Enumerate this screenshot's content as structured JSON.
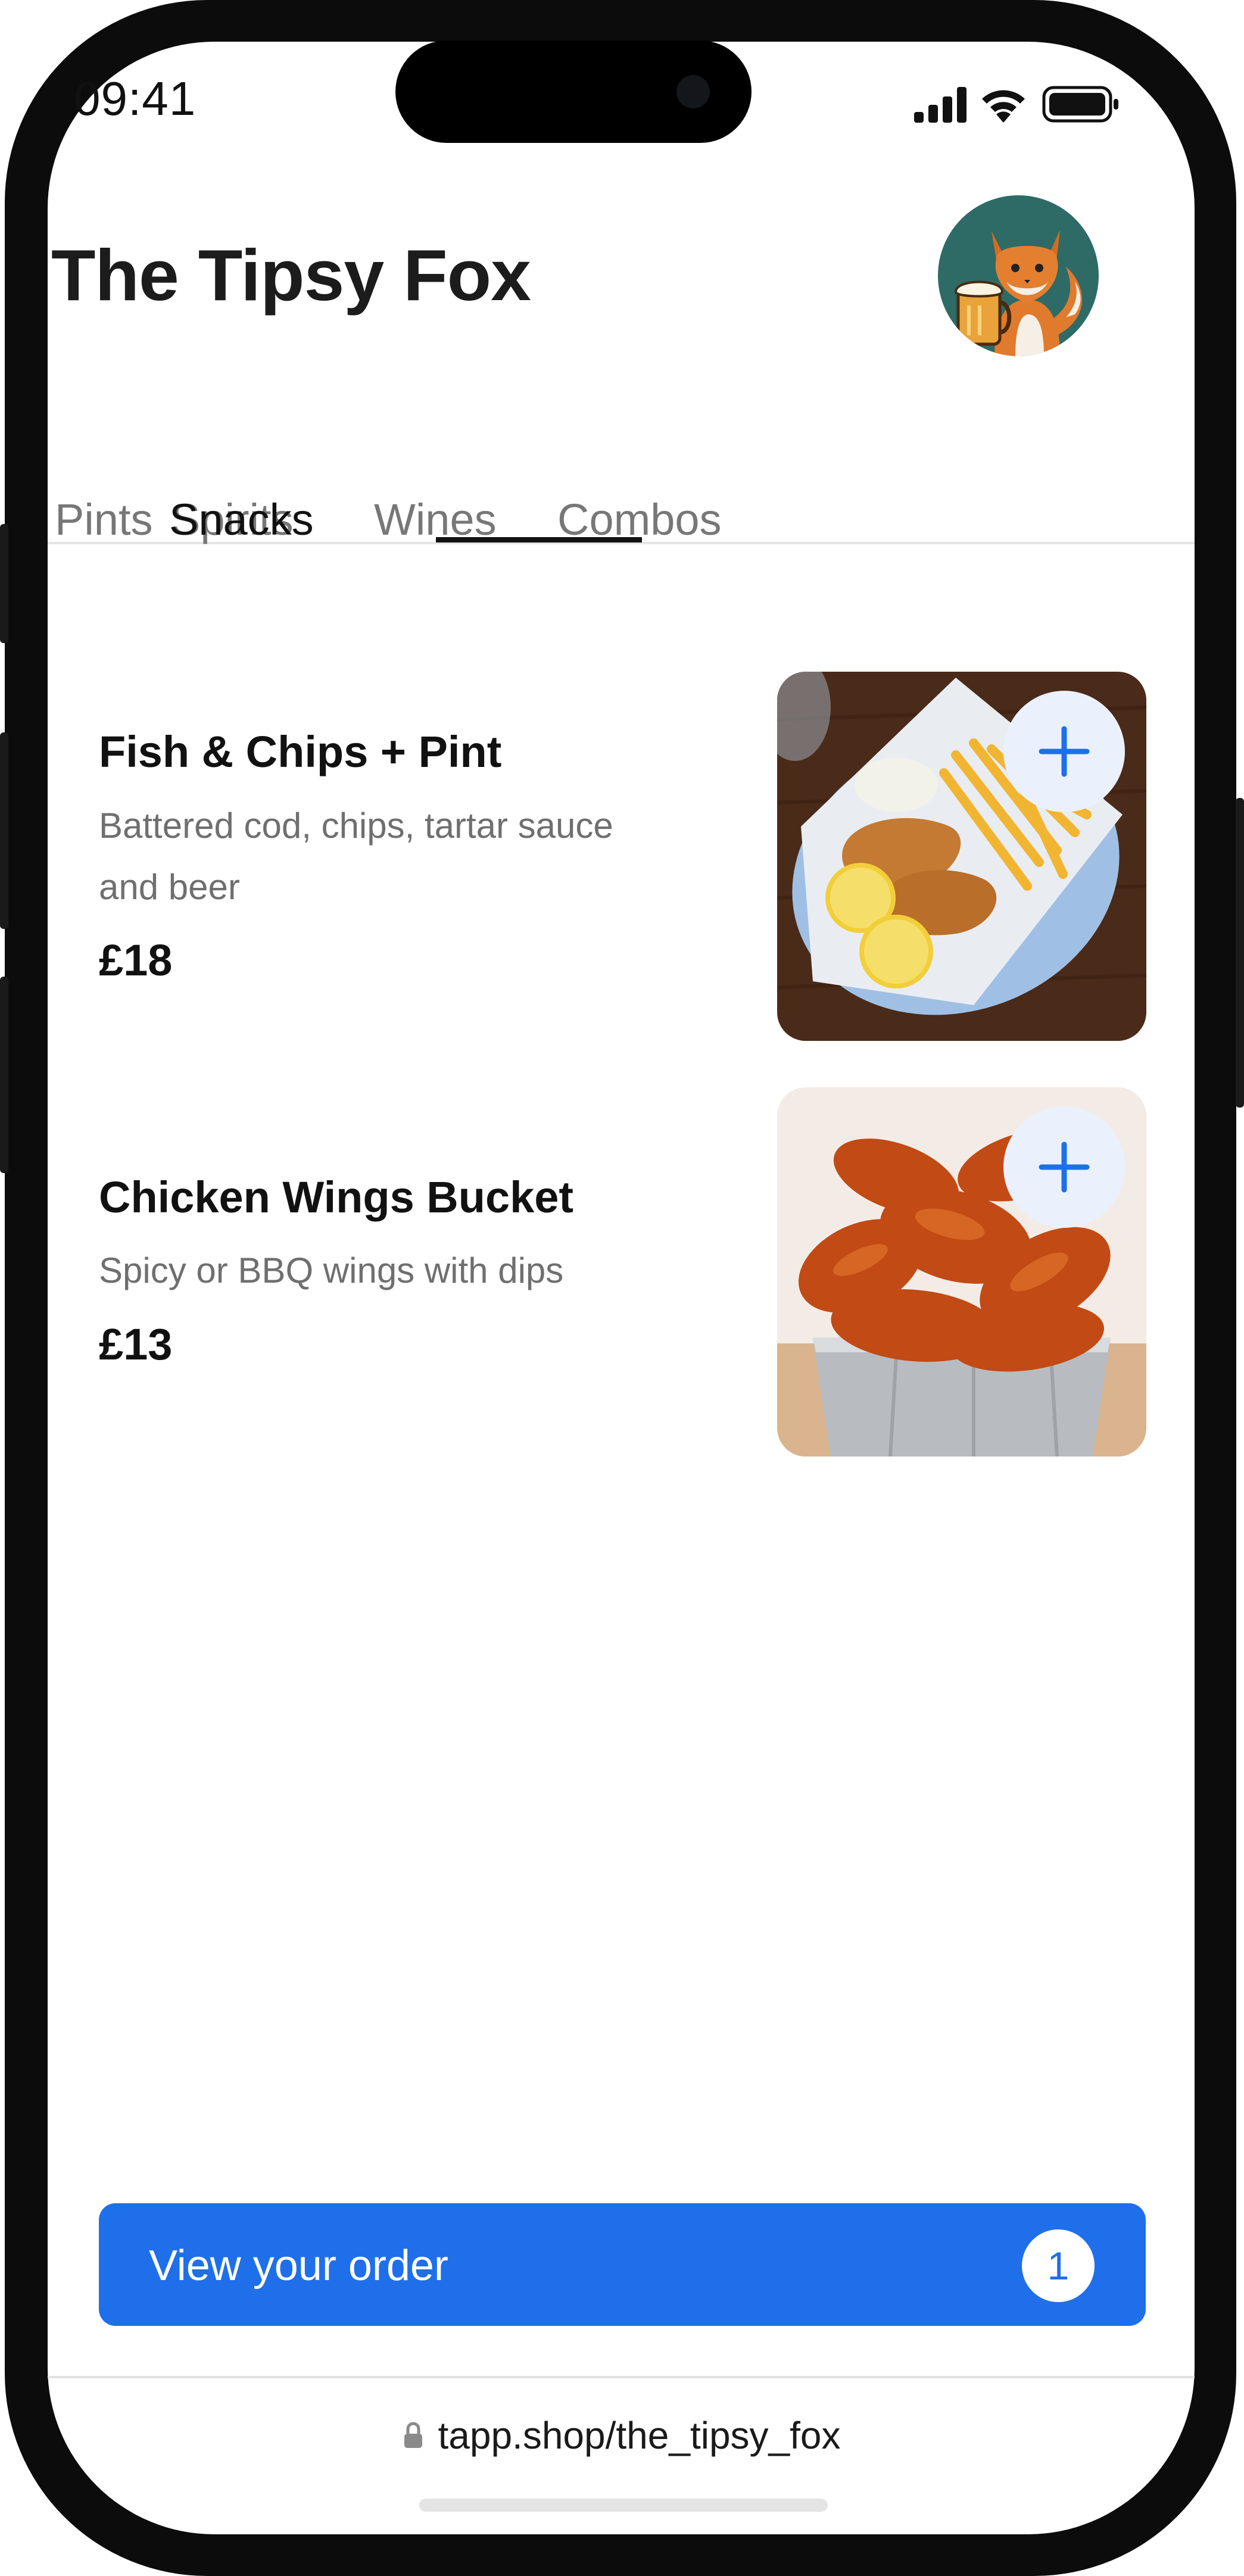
{
  "status_bar": {
    "time": "09:41"
  },
  "header": {
    "title": "The Tipsy Fox",
    "avatar_icon": "fox-with-beer-logo"
  },
  "tabs": [
    {
      "label": "Pints",
      "active": false
    },
    {
      "label": "Spirits",
      "active": false
    },
    {
      "label": "Snacks",
      "active": true
    },
    {
      "label": "Wines",
      "active": false
    },
    {
      "label": "Combos",
      "active": false
    }
  ],
  "menu": {
    "items": [
      {
        "name": "Fish & Chips + Pint",
        "description_line1": "Battered cod, chips, tartar sauce",
        "description_line2": "and beer",
        "price": "£18",
        "image_icon": "fish-and-chips-photo"
      },
      {
        "name": "Chicken Wings Bucket",
        "description_line1": "Spicy or BBQ wings with dips",
        "price": "£13",
        "image_icon": "chicken-wings-photo"
      }
    ]
  },
  "order_bar": {
    "label": "View your order",
    "count": "1"
  },
  "browser": {
    "url": "tapp.shop/the_tipsy_fox",
    "lock_icon": "lock-icon"
  },
  "colors": {
    "accent": "#1f6feb",
    "add_button_bg": "#eaf1fd",
    "avatar_bg": "#2e6b66",
    "title_text": "#1c1c1c",
    "muted_text": "#6f6f6f"
  }
}
